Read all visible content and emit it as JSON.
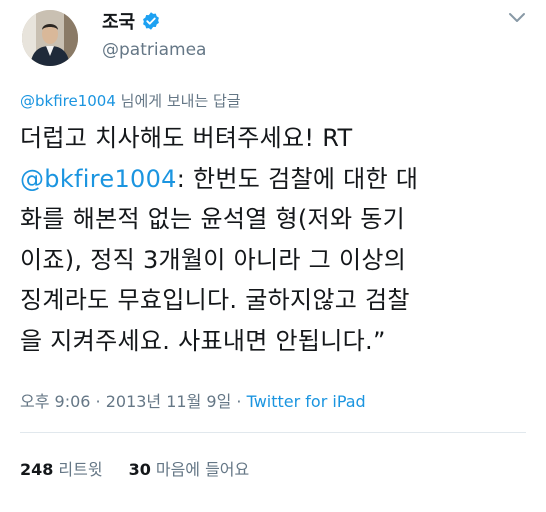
{
  "author": {
    "display_name": "조국",
    "handle": "@patriamea"
  },
  "reply": {
    "mention": "@bkfire1004",
    "suffix": " 님에게 보내는 답글"
  },
  "tweet": {
    "part1": "더럽고 치사해도 버텨주세요! RT\n",
    "mention": "@bkfire1004",
    "part2": ": 한번도 검찰에 대한 대\n화를 해본적 없는 윤석열 형(저와 동기\n이죠), 정직 3개월이 아니라 그 이상의\n징계라도 무효입니다. 굴하지않고 검찰\n을 지켜주세요. 사표내면 안됩니다.”"
  },
  "meta": {
    "timestamp": "오후 9:06 · 2013년 11월 9일",
    "separator": " · ",
    "source": "Twitter for iPad"
  },
  "stats": {
    "retweets_count": "248",
    "retweets_label": "리트윗",
    "likes_count": "30",
    "likes_label": "마음에 들어요"
  },
  "colors": {
    "link": "#1b95e0",
    "muted": "#657786",
    "text": "#14171a",
    "verified": "#1da1f2"
  },
  "icons": {
    "verified": "verified-badge-icon",
    "menu": "chevron-down-icon"
  }
}
